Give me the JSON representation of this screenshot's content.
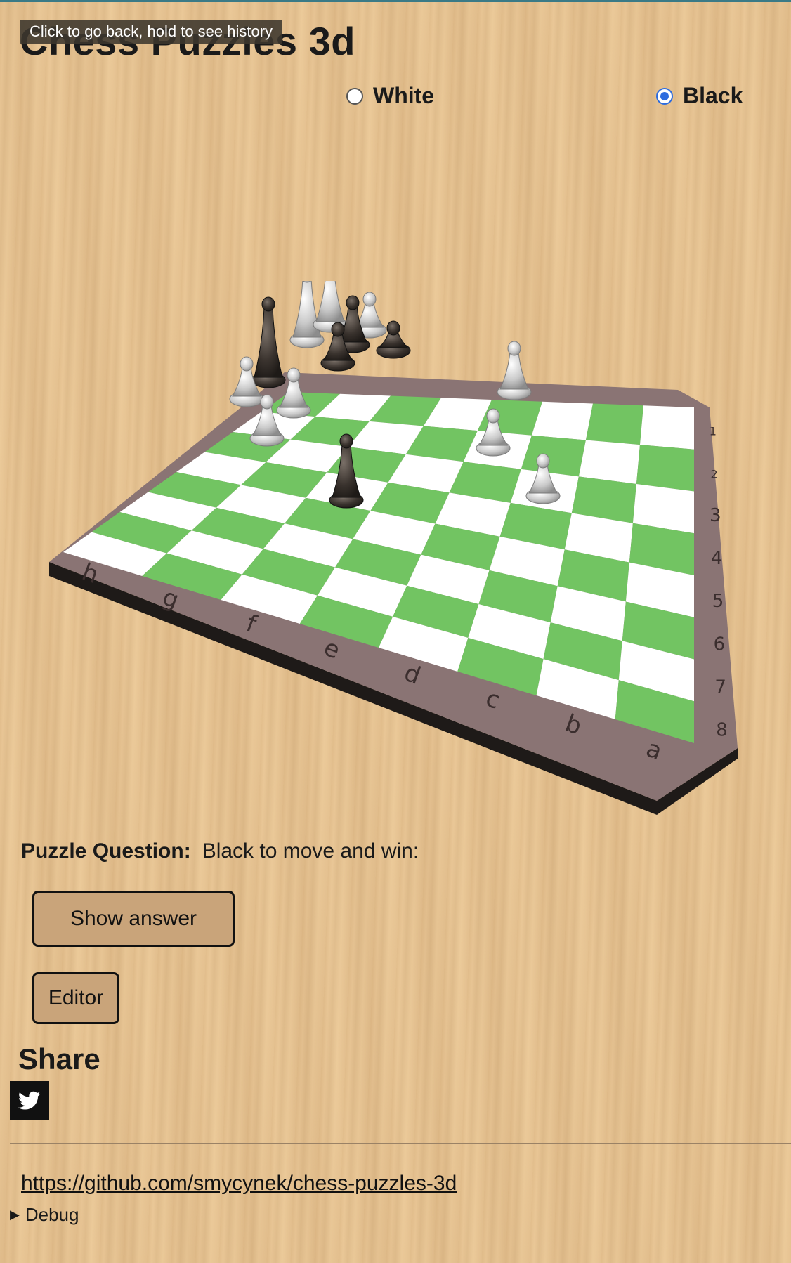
{
  "page": {
    "title": "Chess Puzzles 3d",
    "tooltip": "Click to go back, hold to see history"
  },
  "side_choice": {
    "options": [
      {
        "label": "White",
        "selected": false
      },
      {
        "label": "Black",
        "selected": true
      }
    ]
  },
  "board": {
    "files": [
      "h",
      "g",
      "f",
      "e",
      "d",
      "c",
      "b",
      "a"
    ],
    "ranks": [
      "1",
      "2",
      "3",
      "4",
      "5",
      "6",
      "7",
      "8"
    ],
    "colors": {
      "light": "#ffffff",
      "dark": "#72c462",
      "frame": "#8a7474",
      "base": "#1e1a18"
    }
  },
  "puzzle": {
    "label": "Puzzle Question:",
    "text": "Black to move and win:"
  },
  "buttons": {
    "show_answer": "Show answer",
    "editor": "Editor"
  },
  "share": {
    "heading": "Share",
    "icon": "twitter-icon"
  },
  "footer": {
    "link": "https://github.com/smycynek/chess-puzzles-3d",
    "debug": "Debug"
  }
}
